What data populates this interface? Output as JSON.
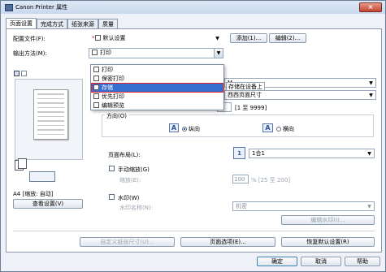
{
  "window": {
    "title": "Canon Printer 属性",
    "close": "×"
  },
  "tabs": [
    "页面设置",
    "完成方式",
    "纸张来源",
    "质量"
  ],
  "profile": {
    "label": "配置文件(F):",
    "value": "默认设置",
    "add": "添加(1)...",
    "edit": "编辑(2)..."
  },
  "output": {
    "label": "输出方法(M):",
    "value": "打印"
  },
  "dropdown": {
    "items": [
      "打印",
      "保密打印",
      "存储",
      "优先打印",
      "编辑预览"
    ],
    "selected_index": 2
  },
  "partial_combo1": "存储在设备上",
  "partial_combo2": "西西页面尺寸",
  "page_size_suffix": "M",
  "copies": {
    "value": "1",
    "range": "[1 至 9999]"
  },
  "orientation": {
    "label": "方向(O)",
    "portrait": "纵向",
    "landscape": "横向",
    "portrait_glyph": "A",
    "landscape_glyph": "A"
  },
  "layout": {
    "label": "页面布局(L):",
    "value": "1合1",
    "badge": "1"
  },
  "manual_scale": {
    "label": "手动缩放(G)",
    "scale_label": "缩放(E):",
    "scale_value": "100",
    "scale_range": "% [25 至 200]"
  },
  "watermark": {
    "label": "水印(W)",
    "name_label": "水印名称(N):",
    "name_value": "机密",
    "edit_button": "编辑水印(I)..."
  },
  "preview_caption": "A4 [缩放: 自动]",
  "view_settings": "查看设置(V)",
  "bottom_buttons": {
    "custom_size": "自定义纸张尺寸(U)...",
    "page_options": "页面选项(E)...",
    "restore": "恢复默认设置(R)"
  },
  "dialog_buttons": {
    "ok": "确定",
    "cancel": "取消",
    "help": "帮助"
  }
}
